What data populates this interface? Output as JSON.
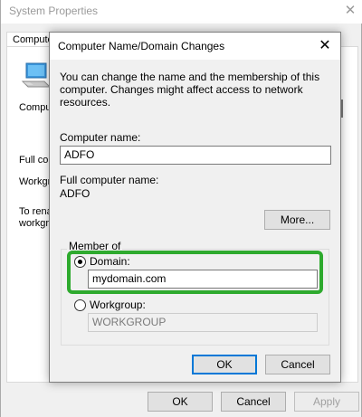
{
  "background_window": {
    "title": "System Properties",
    "tab_label": "Computer Name",
    "fragments": {
      "computer": "Computer description:",
      "full": "Full computer name:",
      "workgroup": "Workgroup:",
      "rename_line1": "To rename this computer or change its",
      "rename_line2": "workgroup, click Change."
    },
    "buttons": {
      "ok": "OK",
      "cancel": "Cancel",
      "apply": "Apply"
    }
  },
  "dialog": {
    "title": "Computer Name/Domain Changes",
    "description": "You can change the name and the membership of this computer. Changes might affect access to network resources.",
    "computer_name_label": "Computer name:",
    "computer_name_value": "ADFO",
    "full_name_label": "Full computer name:",
    "full_name_value": "ADFO",
    "more_button": "More...",
    "member_of_label": "Member of",
    "domain_label": "Domain:",
    "domain_value": "mydomain.com",
    "domain_selected": true,
    "workgroup_label": "Workgroup:",
    "workgroup_value": "WORKGROUP",
    "ok_button": "OK",
    "cancel_button": "Cancel"
  },
  "colors": {
    "highlight": "#2eaa2e",
    "default_button_border": "#0078d7"
  },
  "icons": [
    "close-icon",
    "computer-icon",
    "radio-selected",
    "radio-unselected"
  ]
}
